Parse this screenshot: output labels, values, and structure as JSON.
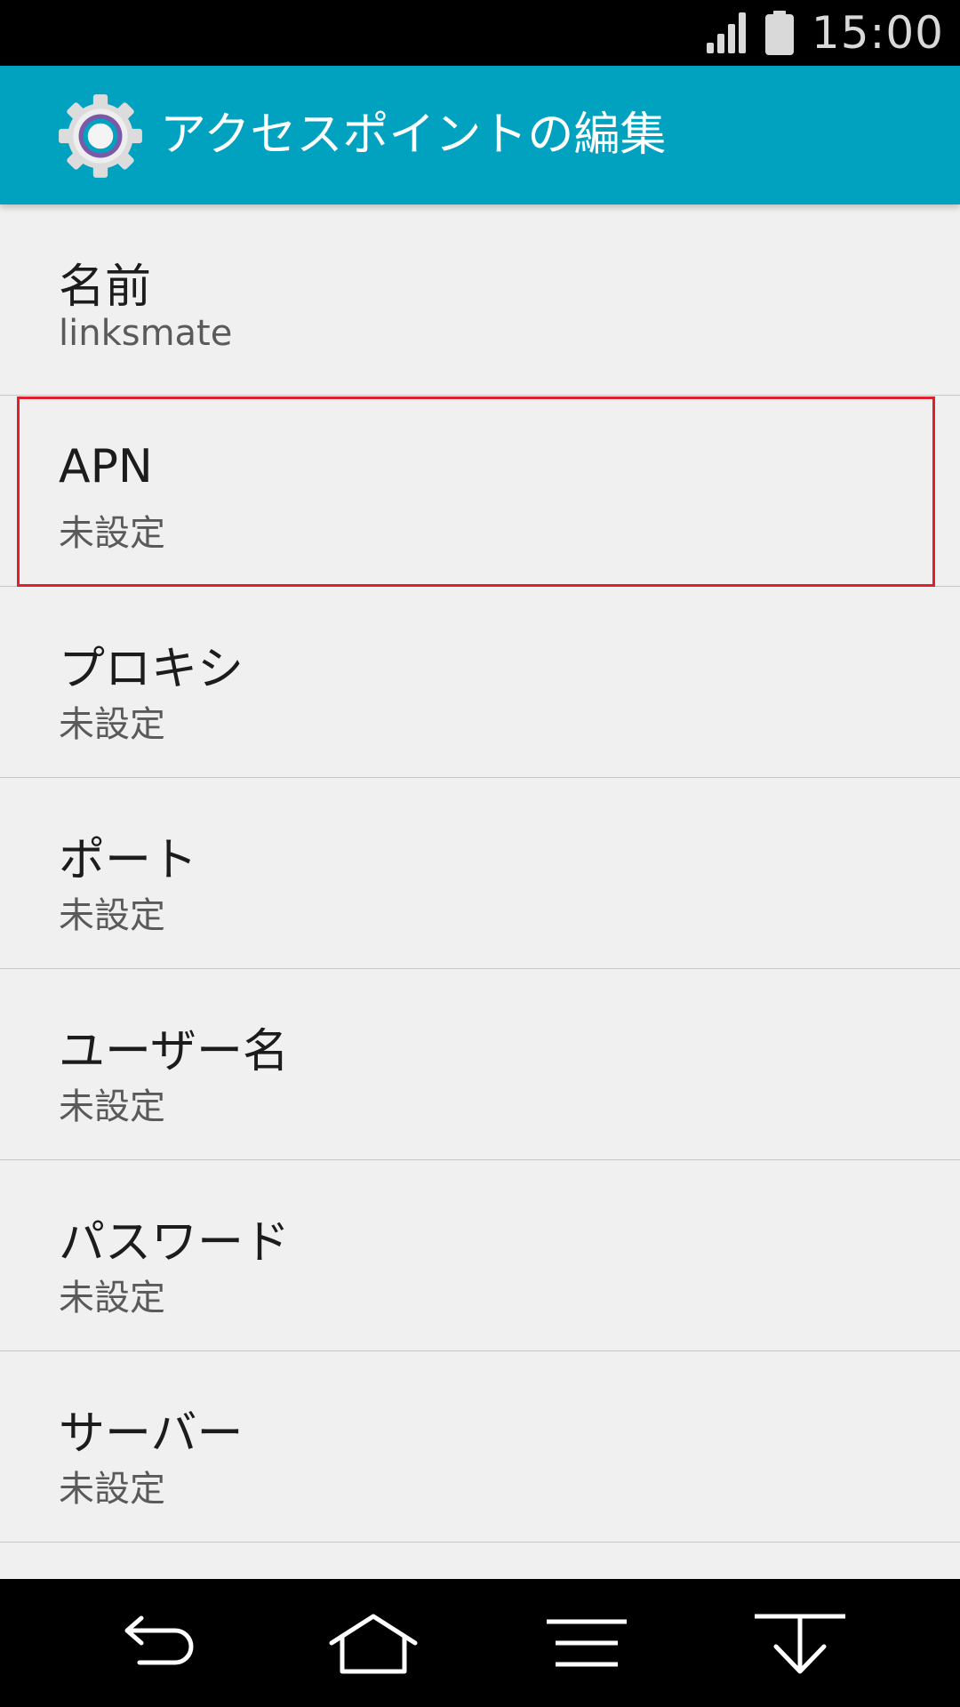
{
  "status_bar": {
    "time": "15:00",
    "icons": [
      "signal-icon",
      "battery-icon"
    ]
  },
  "action_bar": {
    "icon": "settings-gear-icon",
    "title": "アクセスポイントの編集",
    "background_color": "#00a2c0"
  },
  "list": {
    "items": [
      {
        "title": "名前",
        "summary": "linksmate"
      },
      {
        "title": "APN",
        "summary": "未設定"
      },
      {
        "title": "プロキシ",
        "summary": "未設定"
      },
      {
        "title": "ポート",
        "summary": "未設定"
      },
      {
        "title": "ユーザー名",
        "summary": "未設定"
      },
      {
        "title": "パスワード",
        "summary": "未設定"
      },
      {
        "title": "サーバー",
        "summary": "未設定"
      }
    ],
    "highlighted_item": "APN",
    "highlight_color": "#e0202e"
  },
  "nav_bar": {
    "buttons": [
      "back-icon",
      "home-icon",
      "menu-icon",
      "notification-pull-down-icon"
    ]
  }
}
